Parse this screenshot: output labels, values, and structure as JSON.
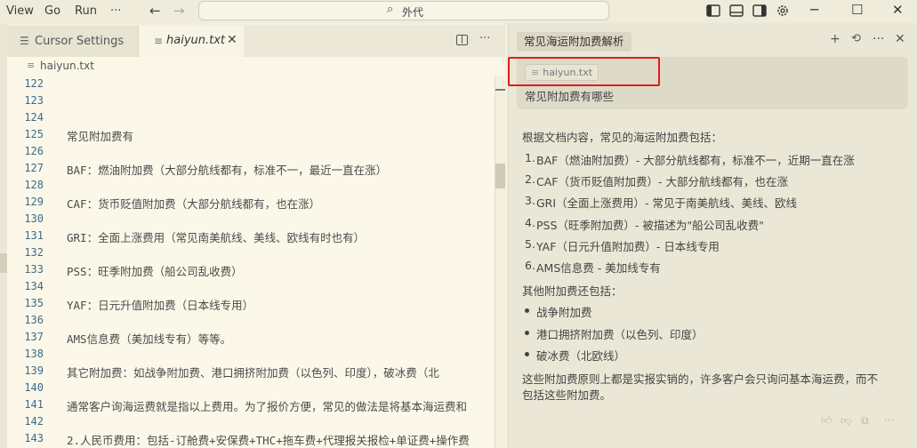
{
  "menu": {
    "view": "View",
    "go": "Go",
    "run": "Run",
    "more": "···"
  },
  "search": {
    "text": "外代"
  },
  "tabs": [
    {
      "label": "Cursor Settings"
    },
    {
      "label": "haiyun.txt"
    }
  ],
  "breadcrumb": {
    "file": "haiyun.txt"
  },
  "editor": {
    "lines": [
      {
        "n": "122",
        "text": ""
      },
      {
        "n": "123",
        "text": ""
      },
      {
        "n": "124",
        "text": ""
      },
      {
        "n": "125",
        "text": "常见附加费有"
      },
      {
        "n": "126",
        "text": ""
      },
      {
        "n": "127",
        "text": "BAF：燃油附加费（大部分航线都有，标准不一，最近一直在涨）"
      },
      {
        "n": "128",
        "text": ""
      },
      {
        "n": "129",
        "text": "CAF：货币贬值附加费（大部分航线都有，也在涨）"
      },
      {
        "n": "130",
        "text": ""
      },
      {
        "n": "131",
        "text": "GRI：全面上涨费用（常见南美航线、美线、欧线有时也有）"
      },
      {
        "n": "132",
        "text": ""
      },
      {
        "n": "133",
        "text": "PSS：旺季附加费（船公司乱收费）"
      },
      {
        "n": "134",
        "text": ""
      },
      {
        "n": "135",
        "text": "YAF：日元升值附加费（日本线专用）"
      },
      {
        "n": "136",
        "text": ""
      },
      {
        "n": "137",
        "text": "AMS信息费（美加线专有）等等。"
      },
      {
        "n": "138",
        "text": ""
      },
      {
        "n": "139",
        "text": "其它附加费：如战争附加费、港口拥挤附加费（以色列、印度），破冰费（北"
      },
      {
        "n": "140",
        "text": ""
      },
      {
        "n": "141",
        "text": "通常客户询海运费就是指以上费用。为了报价方便，常见的做法是将基本海运费和"
      },
      {
        "n": "142",
        "text": ""
      },
      {
        "n": "143",
        "text": "2.人民币费用：包括-订舱费+安保费+THC+拖车费+代理报关报检+单证费+操作费"
      }
    ]
  },
  "chat": {
    "title": "常见海运附加费解析",
    "attachment": "haiyun.txt",
    "user_message": "常见附加费有哪些",
    "intro": "根据文档内容，常见的海运附加费包括：",
    "ordered": [
      "BAF（燃油附加费）- 大部分航线都有，标准不一，近期一直在涨",
      "CAF（货币贬值附加费）- 大部分航线都有，也在涨",
      "GRI（全面上涨费用）- 常见于南美航线、美线、欧线",
      "PSS（旺季附加费）- 被描述为\"船公司乱收费\"",
      "YAF（日元升值附加费）- 日本线专用",
      "AMS信息费 - 美加线专有"
    ],
    "others_heading": "其他附加费还包括：",
    "bullets": [
      "战争附加费",
      "港口拥挤附加费（以色列、印度）",
      "破冰费（北欧线）"
    ],
    "closing_line1": "这些附加费原则上都是实报实销的，许多客户会只询问基本海运费，而不",
    "closing_line2": "包括这些附加费。"
  },
  "colors": {
    "background": "#f3efe0",
    "editor_bg": "#fcf8e9",
    "line_number": "#3b6b8a",
    "highlight_box": "#e21b1b"
  }
}
